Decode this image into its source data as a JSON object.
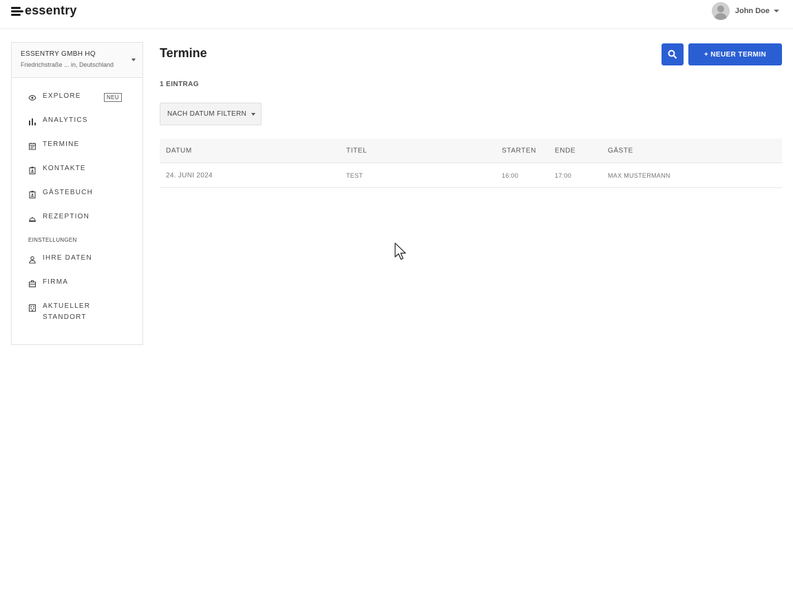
{
  "app": {
    "logo_text": "essentry"
  },
  "user": {
    "name": "John Doe"
  },
  "location": {
    "name": "ESSENTRY GMBH HQ",
    "address": "Friedrichstraße ... in, Deutschland"
  },
  "nav": {
    "items": [
      {
        "label": "EXPLORE",
        "icon": "eye-icon",
        "badge": "NEU"
      },
      {
        "label": "ANALYTICS",
        "icon": "bar-chart-icon"
      },
      {
        "label": "TERMINE",
        "icon": "calendar-icon"
      },
      {
        "label": "KONTAKTE",
        "icon": "contact-badge-icon"
      },
      {
        "label": "GÄSTEBUCH",
        "icon": "guestbook-badge-icon"
      },
      {
        "label": "REZEPTION",
        "icon": "reception-bell-icon"
      }
    ],
    "section": "EINSTELLUNGEN",
    "settings": [
      {
        "label": "IHRE DATEN",
        "icon": "person-icon"
      },
      {
        "label": "FIRMA",
        "icon": "briefcase-icon"
      },
      {
        "label": "AKTUELLER STANDORT",
        "icon": "building-icon"
      }
    ]
  },
  "main": {
    "title": "Termine",
    "new_button": "+ NEUER TERMIN",
    "count": "1 EINTRAG",
    "filter_label": "NACH DATUM FILTERN"
  },
  "table": {
    "headers": [
      "DATUM",
      "TITEL",
      "STARTEN",
      "ENDE",
      "GÄSTE"
    ],
    "rows": [
      [
        "24. JUNI 2024",
        "TEST",
        "16:00",
        "17:00",
        "MAX MUSTERMANN"
      ]
    ]
  },
  "colors": {
    "accent": "#2a5fd4"
  }
}
